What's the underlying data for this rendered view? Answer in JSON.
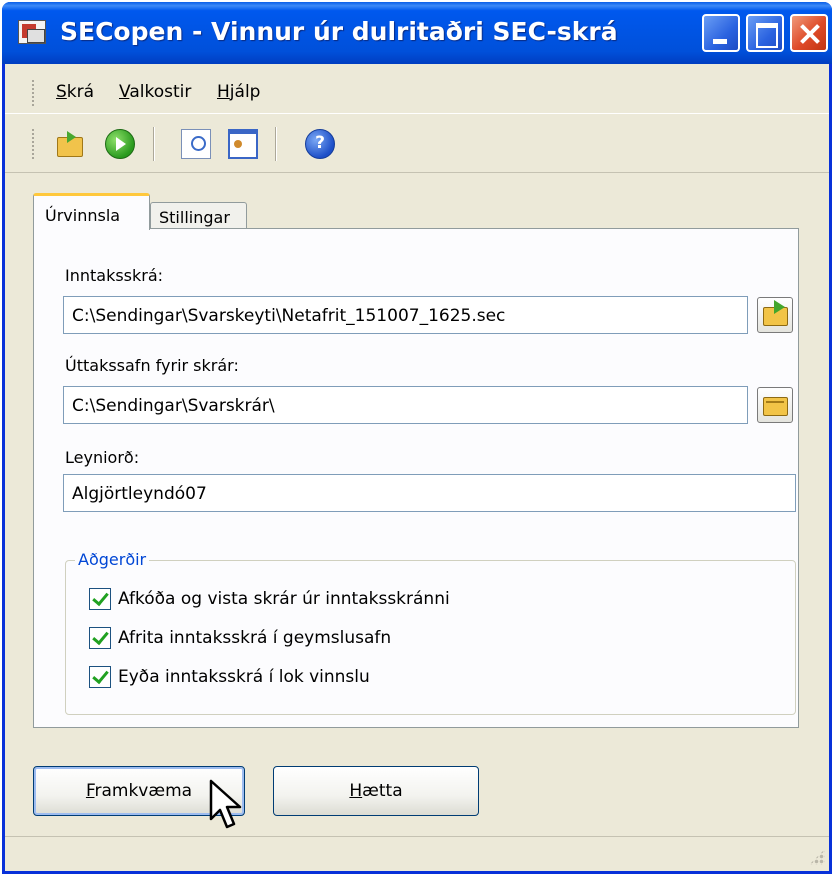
{
  "window": {
    "title": "SECopen - Vinnur úr dulritaðri SEC-skrá"
  },
  "menu": {
    "items": [
      {
        "accel": "S",
        "rest": "krá"
      },
      {
        "accel": "V",
        "rest": "alkostir"
      },
      {
        "accel": "H",
        "rest": "jálp"
      }
    ]
  },
  "toolbar": {
    "icons": [
      "open-folder-icon",
      "go-arrow-icon",
      "preview-icon",
      "card-icon",
      "help-icon"
    ],
    "help_glyph": "?"
  },
  "tabs": [
    {
      "label": "Úrvinnsla",
      "active": true
    },
    {
      "label": "Stillingar",
      "active": false
    }
  ],
  "form": {
    "input_file_label": "Inntaksskrá:",
    "input_file_value": "C:\\Sendingar\\Svarskeyti\\Netafrit_151007_1625.sec",
    "output_folder_label": "Úttakssafn fyrir skrár:",
    "output_folder_value": "C:\\Sendingar\\Svarskrár\\",
    "password_label": "Leyniorð:",
    "password_value": "Algjörtleyndó07"
  },
  "actions_group": {
    "title": "Aðgerðir",
    "options": [
      {
        "label": "Afkóða og vista skrár úr inntaksskránni",
        "checked": true
      },
      {
        "label": "Afrita inntaksskrá í geymslusafn",
        "checked": true
      },
      {
        "label": "Eyða inntaksskrá í lok vinnslu",
        "checked": true
      }
    ]
  },
  "buttons": {
    "run": {
      "accel": "F",
      "rest": "ramkvæma"
    },
    "cancel": {
      "accel": "H",
      "rest": "ætta"
    }
  },
  "colors": {
    "titlebar": "#0054e3",
    "window_bg": "#ece9d8",
    "group_title": "#0046d5",
    "active_tab_accent": "#ffc83c"
  }
}
